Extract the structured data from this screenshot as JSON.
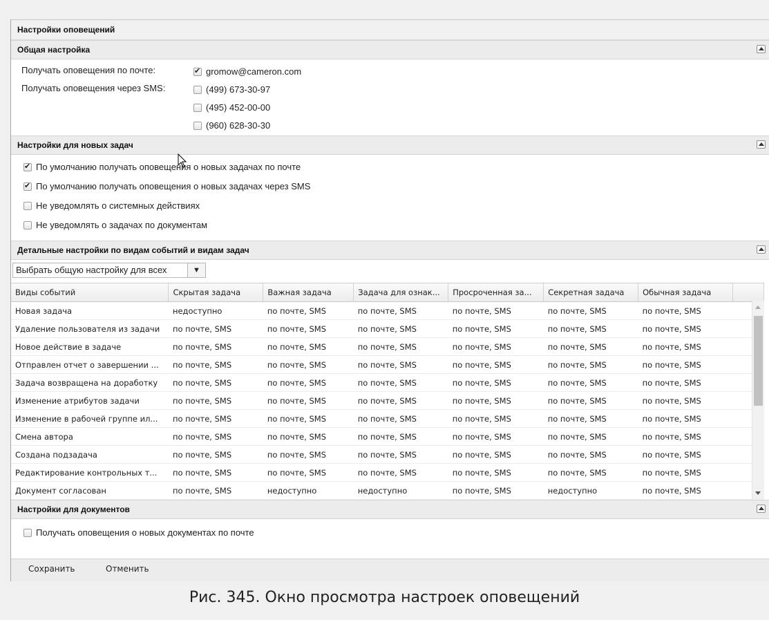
{
  "window": {
    "title": "Настройки оповещений"
  },
  "general": {
    "header": "Общая настройка",
    "email_label": "Получать оповещения по почте:",
    "sms_label": "Получать оповещения через SMS:",
    "email": {
      "address": "gromow@cameron.com",
      "checked": true
    },
    "phones": [
      {
        "number": "(499) 673-30-97",
        "checked": false
      },
      {
        "number": "(495) 452-00-00",
        "checked": false
      },
      {
        "number": "(960) 628-30-30",
        "checked": false
      }
    ]
  },
  "new_tasks": {
    "header": "Настройки для новых задач",
    "options": [
      {
        "label": "По умолчанию получать оповещения о новых задачах по почте",
        "checked": true
      },
      {
        "label": "По умолчанию получать оповещения о новых задачах через SMS",
        "checked": true
      },
      {
        "label": "Не уведомлять о системных действиях",
        "checked": false
      },
      {
        "label": "Не уведомлять о задачах по документам",
        "checked": false
      }
    ]
  },
  "detailed": {
    "header": "Детальные настройки по видам событий и видам задач",
    "combo_value": "Выбрать общую настройку для всех",
    "columns": [
      "Виды событий",
      "Скрытая задача",
      "Важная задача",
      "Задача для ознак...",
      "Просроченная за...",
      "Секретная задача",
      "Обычная задача"
    ],
    "rows": [
      [
        "Новая задача",
        "недоступно",
        "по почте, SMS",
        "по почте, SMS",
        "по почте, SMS",
        "по почте, SMS",
        "по почте, SMS"
      ],
      [
        "Удаление пользователя из задачи",
        "по почте, SMS",
        "по почте, SMS",
        "по почте, SMS",
        "по почте, SMS",
        "по почте, SMS",
        "по почте, SMS"
      ],
      [
        "Новое действие в задаче",
        "по почте, SMS",
        "по почте, SMS",
        "по почте, SMS",
        "по почте, SMS",
        "по почте, SMS",
        "по почте, SMS"
      ],
      [
        "Отправлен отчет о завершении ...",
        "по почте, SMS",
        "по почте, SMS",
        "по почте, SMS",
        "по почте, SMS",
        "по почте, SMS",
        "по почте, SMS"
      ],
      [
        "Задача возвращена на доработку",
        "по почте, SMS",
        "по почте, SMS",
        "по почте, SMS",
        "по почте, SMS",
        "по почте, SMS",
        "по почте, SMS"
      ],
      [
        "Изменение атрибутов задачи",
        "по почте, SMS",
        "по почте, SMS",
        "по почте, SMS",
        "по почте, SMS",
        "по почте, SMS",
        "по почте, SMS"
      ],
      [
        "Изменение в рабочей группе ил...",
        "по почте, SMS",
        "по почте, SMS",
        "по почте, SMS",
        "по почте, SMS",
        "по почте, SMS",
        "по почте, SMS"
      ],
      [
        "Смена автора",
        "по почте, SMS",
        "по почте, SMS",
        "по почте, SMS",
        "по почте, SMS",
        "по почте, SMS",
        "по почте, SMS"
      ],
      [
        "Создана подзадача",
        "по почте, SMS",
        "по почте, SMS",
        "по почте, SMS",
        "по почте, SMS",
        "по почте, SMS",
        "по почте, SMS"
      ],
      [
        "Редактирование контрольных т...",
        "по почте, SMS",
        "по почте, SMS",
        "по почте, SMS",
        "по почте, SMS",
        "по почте, SMS",
        "по почте, SMS"
      ],
      [
        "Документ согласован",
        "по почте, SMS",
        "недоступно",
        "недоступно",
        "по почте, SMS",
        "недоступно",
        "по почте, SMS"
      ]
    ]
  },
  "documents": {
    "header": "Настройки для документов",
    "option": {
      "label": "Получать оповещения о новых документах по почте",
      "checked": false
    }
  },
  "footer": {
    "save_label": "Сохранить",
    "cancel_label": "Отменить"
  },
  "caption": "Рис. 345. Окно просмотра настроек оповещений",
  "icons": {
    "collapse": "collapse-up-icon",
    "combo_arrow": "chevron-down-icon",
    "cursor": "mouse-cursor-icon"
  }
}
